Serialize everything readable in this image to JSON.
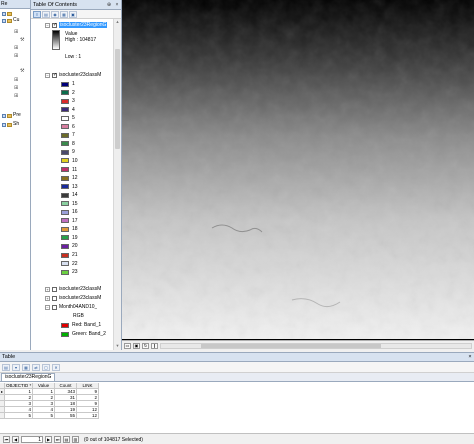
{
  "catalog": {
    "title": "Re",
    "items": [
      {
        "label": "",
        "icon": "folder-icon"
      },
      {
        "label": "Cu",
        "icon": "folder-icon"
      },
      {
        "label": "",
        "icon": "tool-icon"
      },
      {
        "label": "",
        "icon": "tool-icon"
      },
      {
        "label": "",
        "icon": "tool-icon"
      },
      {
        "label": "",
        "icon": "tool-icon"
      },
      {
        "label": "",
        "icon": "tool-icon"
      },
      {
        "label": "",
        "icon": "tool-icon"
      },
      {
        "label": "",
        "icon": "tool-icon"
      },
      {
        "label": "Pre",
        "icon": "folder-icon"
      },
      {
        "label": "Sh",
        "icon": "folder-icon"
      }
    ]
  },
  "toc": {
    "title": "Table Of Contents",
    "pin_glyph": "⊕",
    "close_glyph": "×",
    "layers": [
      {
        "name": "isocluster23RegionG",
        "checked": true,
        "expanded": true,
        "selected": true
      },
      {
        "name": "isocluster23classM",
        "checked": true,
        "expanded": true,
        "selected": false
      },
      {
        "name": "isocluster23classM",
        "checked": false,
        "expanded": false,
        "selected": false
      },
      {
        "name": "isocluster23classM",
        "checked": false,
        "expanded": false,
        "selected": false
      },
      {
        "name": "Month04AND10_",
        "checked": false,
        "expanded": true,
        "selected": false
      }
    ],
    "raster_legend": {
      "value_label": "Value",
      "high": "High : 104817",
      "low": "Low : 1"
    },
    "classes": [
      {
        "label": "1",
        "color": "#00007a"
      },
      {
        "label": "2",
        "color": "#0b6e4c"
      },
      {
        "label": "3",
        "color": "#d92a2a"
      },
      {
        "label": "4",
        "color": "#3d2a7a"
      },
      {
        "label": "5",
        "color": "#ffffff"
      },
      {
        "label": "6",
        "color": "#d77ea0"
      },
      {
        "label": "7",
        "color": "#6c6c2a"
      },
      {
        "label": "8",
        "color": "#3a8a4c"
      },
      {
        "label": "9",
        "color": "#4a4a6a"
      },
      {
        "label": "10",
        "color": "#e0d020"
      },
      {
        "label": "11",
        "color": "#c0306a"
      },
      {
        "label": "12",
        "color": "#8a7020"
      },
      {
        "label": "13",
        "color": "#1a2a9a"
      },
      {
        "label": "14",
        "color": "#3a3a3a"
      },
      {
        "label": "15",
        "color": "#8ad0a0"
      },
      {
        "label": "16",
        "color": "#9aa0d8"
      },
      {
        "label": "17",
        "color": "#c070c0"
      },
      {
        "label": "18",
        "color": "#e09a3a"
      },
      {
        "label": "19",
        "color": "#28a048"
      },
      {
        "label": "20",
        "color": "#6a20a0"
      },
      {
        "label": "21",
        "color": "#c83020"
      },
      {
        "label": "22",
        "color": "#d8e0f0"
      },
      {
        "label": "23",
        "color": "#6ad040"
      }
    ],
    "rgb": {
      "title": "RGB",
      "red": "Red:  Band_1",
      "green": "Green: Band_2",
      "red_color": "#e00000",
      "green_color": "#00b000"
    }
  },
  "table": {
    "panel_title": "Table",
    "tab_label": "isocluster23RegionG",
    "columns": [
      "OBJECTID *",
      "Value",
      "Count",
      "LINK"
    ],
    "rows": [
      [
        "1",
        "1",
        "343",
        "9"
      ],
      [
        "2",
        "2",
        "31",
        "2"
      ],
      [
        "3",
        "3",
        "18",
        "9"
      ],
      [
        "4",
        "4",
        "19",
        "12"
      ],
      [
        "5",
        "5",
        "55",
        "12"
      ]
    ],
    "current_record": "1",
    "status": "(0 out of 104817 Selected)"
  }
}
